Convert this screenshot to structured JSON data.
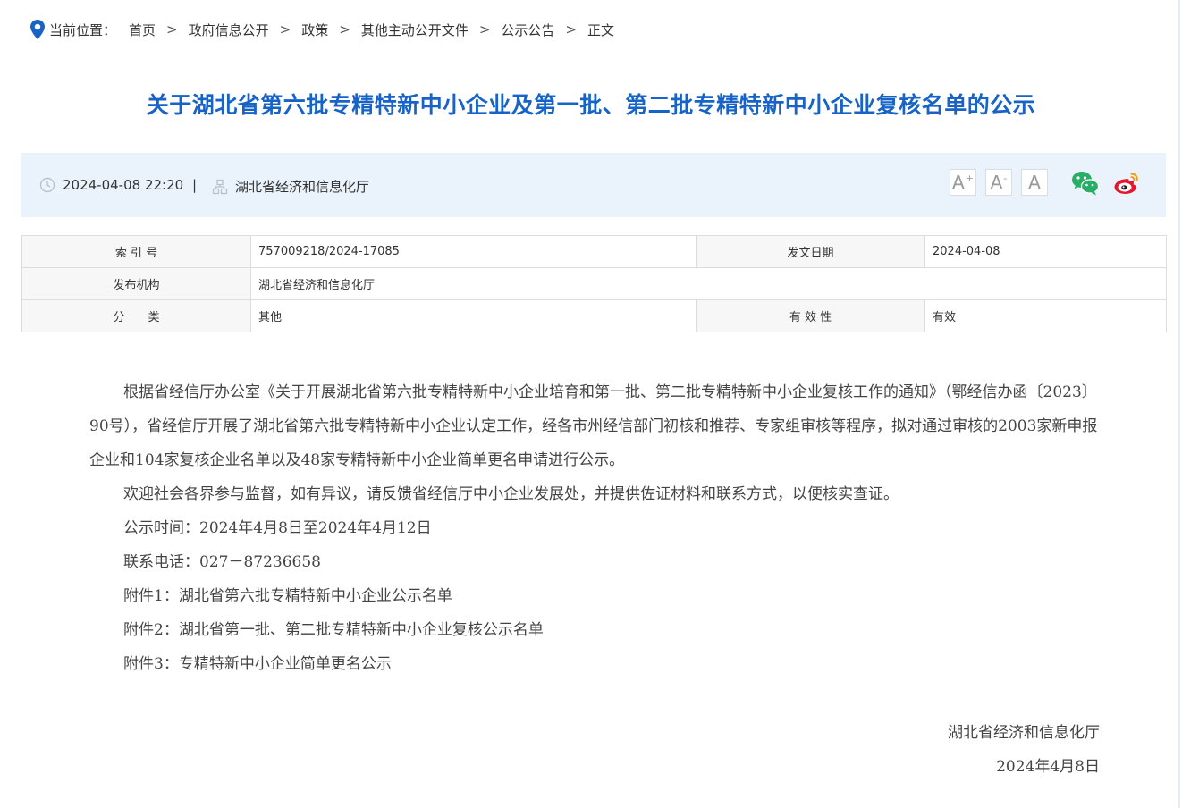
{
  "breadcrumb": {
    "label": "当前位置：",
    "items": [
      "首页",
      "政府信息公开",
      "政策",
      "其他主动公开文件",
      "公示公告",
      "正文"
    ],
    "separator": ">"
  },
  "title": "关于湖北省第六批专精特新中小企业及第一批、第二批专精特新中小企业复核名单的公示",
  "info": {
    "datetime": "2024-04-08 22:20",
    "separator": "|",
    "source": "湖北省经济和信息化厅",
    "font_larger": "A",
    "font_larger_sup": "+",
    "font_smaller": "A",
    "font_smaller_sup": "-",
    "font_reset": "A",
    "share_icons": [
      "wechat-icon",
      "weibo-icon"
    ]
  },
  "meta_table": {
    "index_label": "索 引 号",
    "index_value": "757009218/2024-17085",
    "date_label": "发文日期",
    "date_value": "2024-04-08",
    "org_label": "发布机构",
    "org_value": "湖北省经济和信息化厅",
    "category_label": "分　　类",
    "category_value": "其他",
    "validity_label": "有 效 性",
    "validity_value": "有效"
  },
  "body": {
    "para1": "根据省经信厅办公室《关于开展湖北省第六批专精特新中小企业培育和第一批、第二批专精特新中小企业复核工作的通知》（鄂经信办函〔2023〕90号），省经信厅开展了湖北省第六批专精特新中小企业认定工作，经各市州经信部门初核和推荐、专家组审核等程序，拟对通过审核的2003家新申报企业和104家复核企业名单以及48家专精特新中小企业简单更名申请进行公示。",
    "para2": "欢迎社会各界参与监督，如有异议，请反馈省经信厅中小企业发展处，并提供佐证材料和联系方式，以便核实查证。",
    "period": "公示时间：2024年4月8日至2024年4月12日",
    "phone": "联系电话：027－87236658",
    "attachments": [
      "附件1：湖北省第六批专精特新中小企业公示名单",
      "附件2：湖北省第一批、第二批专精特新中小企业复核公示名单",
      "附件3：专精特新中小企业简单更名公示"
    ],
    "signature": "湖北省经济和信息化厅",
    "sign_date": "2024年4月8日"
  },
  "colors": {
    "title": "#1763c7",
    "location_icon": "#1763c7",
    "infobar_bg": "#eaf3fc",
    "wechat": "#2aae67",
    "weibo": "#e6162d"
  }
}
